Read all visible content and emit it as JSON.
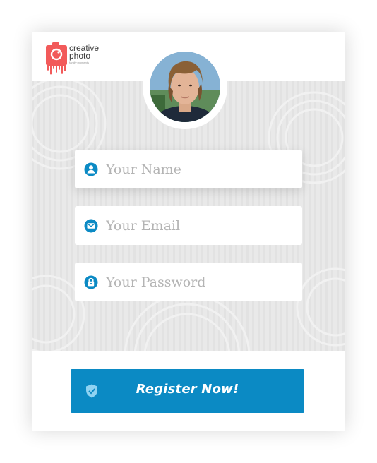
{
  "brand": {
    "name_line1": "creative",
    "name_line2": "photo",
    "tagline": "family moments",
    "logo_color": "#f25a5a"
  },
  "profile": {
    "avatar_icon": "user-photo"
  },
  "form": {
    "name": {
      "placeholder": "Your Name",
      "value": "",
      "icon": "user-icon"
    },
    "email": {
      "placeholder": "Your Email",
      "value": "",
      "icon": "envelope-icon"
    },
    "password": {
      "placeholder": "Your Password",
      "value": "",
      "icon": "lock-icon"
    }
  },
  "submit": {
    "label": "Register Now!",
    "icon": "shield-check-icon",
    "color": "#0b8ac4"
  },
  "colors": {
    "icon_blue": "#0b8ac4",
    "placeholder": "#b4b4b4",
    "panel_bg": "#e9e9e9"
  }
}
